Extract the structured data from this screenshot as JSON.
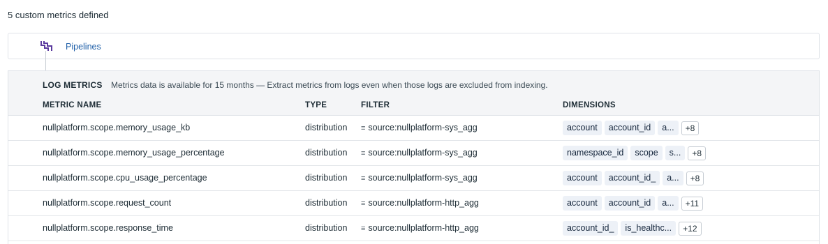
{
  "summary": "5 custom metrics defined",
  "pipelines": {
    "label": "Pipelines",
    "icon": "pipeline-icon"
  },
  "log_metrics": {
    "title": "LOG METRICS",
    "description": "Metrics data is available for 15 months — Extract metrics from logs even when those logs are excluded from indexing.",
    "columns": {
      "name": "METRIC NAME",
      "type": "TYPE",
      "filter": "FILTER",
      "dimensions": "DIMENSIONS"
    },
    "rows": [
      {
        "name": "nullplatform.scope.memory_usage_kb",
        "type": "distribution",
        "filter": "source:nullplatform-sys_agg",
        "tags": [
          "account",
          "account_id",
          "a..."
        ],
        "more": "+8"
      },
      {
        "name": "nullplatform.scope.memory_usage_percentage",
        "type": "distribution",
        "filter": "source:nullplatform-sys_agg",
        "tags": [
          "namespace_id",
          "scope",
          "s..."
        ],
        "more": "+8"
      },
      {
        "name": "nullplatform.scope.cpu_usage_percentage",
        "type": "distribution",
        "filter": "source:nullplatform-sys_agg",
        "tags": [
          "account",
          "account_id_",
          "a..."
        ],
        "more": "+8"
      },
      {
        "name": "nullplatform.scope.request_count",
        "type": "distribution",
        "filter": "source:nullplatform-http_agg",
        "tags": [
          "account",
          "account_id",
          "a..."
        ],
        "more": "+11"
      },
      {
        "name": "nullplatform.scope.response_time",
        "type": "distribution",
        "filter": "source:nullplatform-http_agg",
        "tags": [
          "account_id_",
          "is_healthc..."
        ],
        "more": "+12"
      }
    ]
  },
  "colors": {
    "link": "#1f5fa8",
    "icon": "#5b3a9e",
    "tag_bg": "#edf1f7",
    "header_bg": "#f4f5f7"
  }
}
